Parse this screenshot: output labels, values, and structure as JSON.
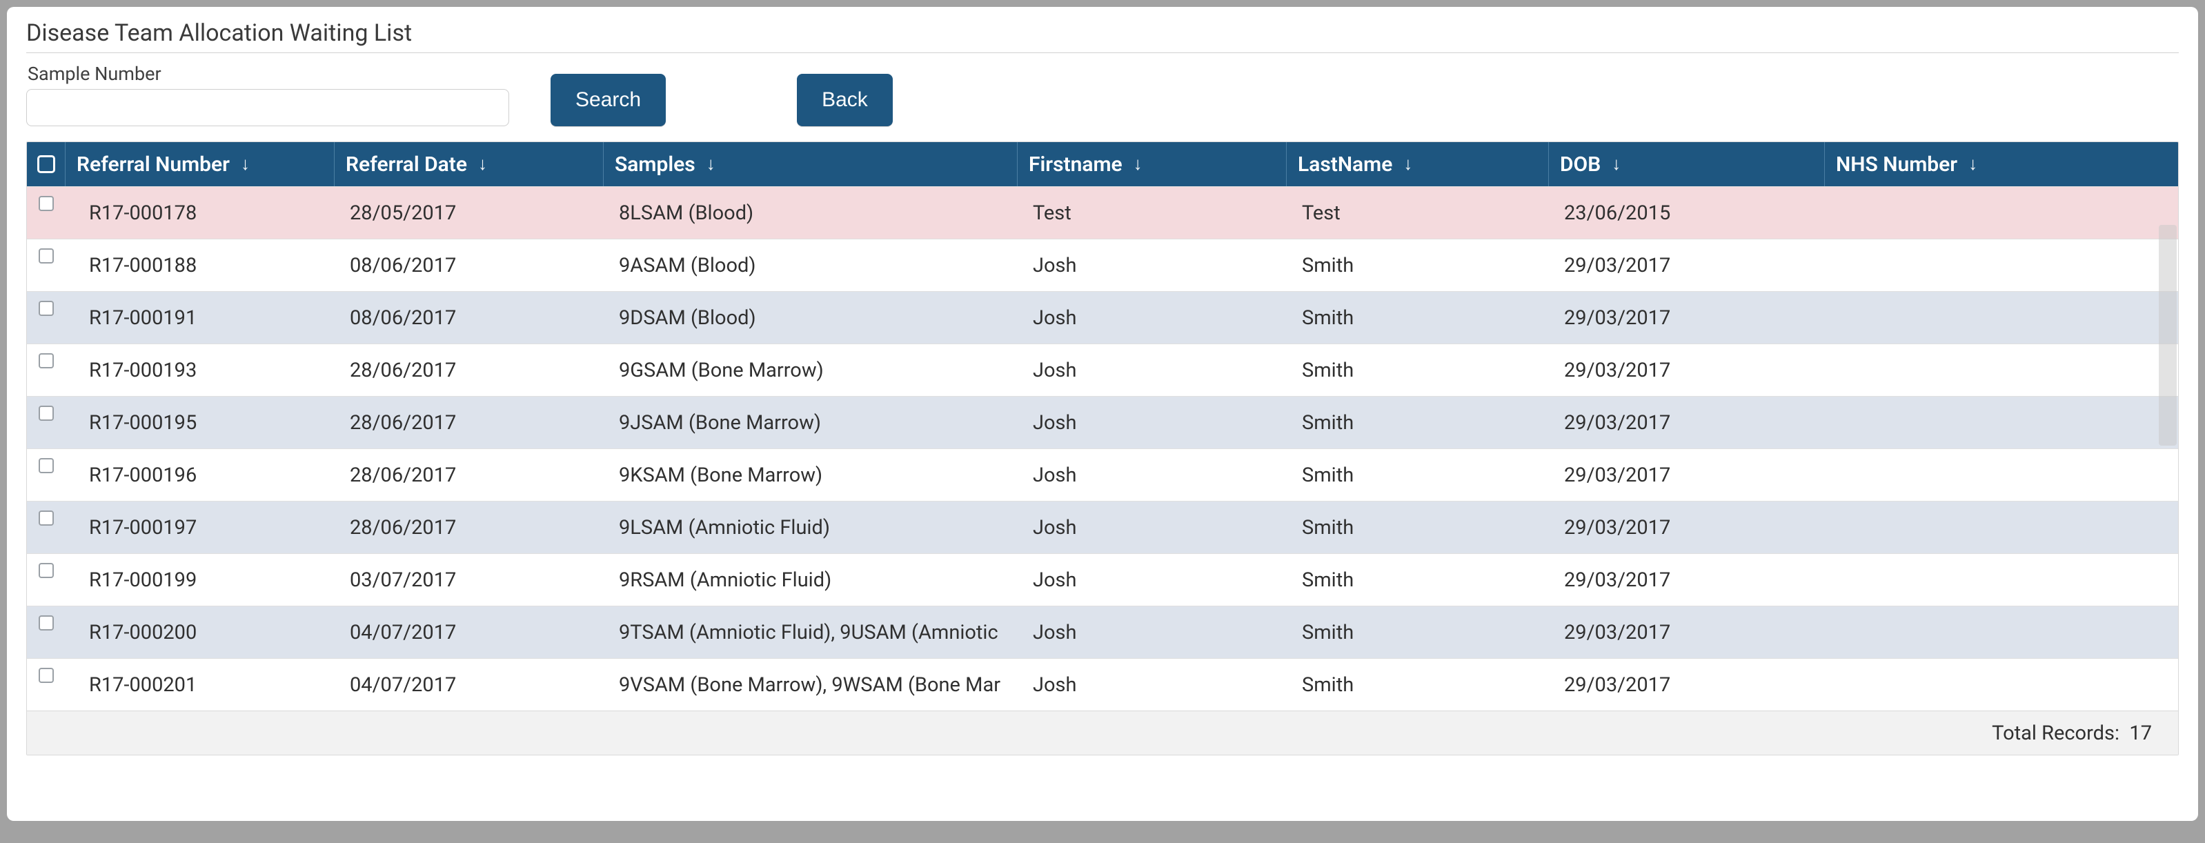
{
  "title": "Disease Team Allocation Waiting List",
  "controls": {
    "sample_number_label": "Sample Number",
    "sample_number_value": "",
    "search_label": "Search",
    "back_label": "Back"
  },
  "columns": {
    "referral_number": "Referral Number",
    "referral_date": "Referral Date",
    "samples": "Samples",
    "firstname": "Firstname",
    "lastname": "LastName",
    "dob": "DOB",
    "nhs_number": "NHS Number"
  },
  "rows": [
    {
      "ref": "R17-000178",
      "date": "28/05/2017",
      "samples": "8LSAM (Blood)",
      "first": "Test",
      "last": "Test",
      "dob": "23/06/2015",
      "nhs": "",
      "highlight": true
    },
    {
      "ref": "R17-000188",
      "date": "08/06/2017",
      "samples": "9ASAM (Blood)",
      "first": "Josh",
      "last": "Smith",
      "dob": "29/03/2017",
      "nhs": ""
    },
    {
      "ref": "R17-000191",
      "date": "08/06/2017",
      "samples": "9DSAM (Blood)",
      "first": "Josh",
      "last": "Smith",
      "dob": "29/03/2017",
      "nhs": ""
    },
    {
      "ref": "R17-000193",
      "date": "28/06/2017",
      "samples": "9GSAM (Bone Marrow)",
      "first": "Josh",
      "last": "Smith",
      "dob": "29/03/2017",
      "nhs": ""
    },
    {
      "ref": "R17-000195",
      "date": "28/06/2017",
      "samples": "9JSAM (Bone Marrow)",
      "first": "Josh",
      "last": "Smith",
      "dob": "29/03/2017",
      "nhs": ""
    },
    {
      "ref": "R17-000196",
      "date": "28/06/2017",
      "samples": "9KSAM (Bone Marrow)",
      "first": "Josh",
      "last": "Smith",
      "dob": "29/03/2017",
      "nhs": ""
    },
    {
      "ref": "R17-000197",
      "date": "28/06/2017",
      "samples": "9LSAM (Amniotic Fluid)",
      "first": "Josh",
      "last": "Smith",
      "dob": "29/03/2017",
      "nhs": ""
    },
    {
      "ref": "R17-000199",
      "date": "03/07/2017",
      "samples": "9RSAM (Amniotic Fluid)",
      "first": "Josh",
      "last": "Smith",
      "dob": "29/03/2017",
      "nhs": ""
    },
    {
      "ref": "R17-000200",
      "date": "04/07/2017",
      "samples": "9TSAM (Amniotic Fluid), 9USAM (Amniotic",
      "first": "Josh",
      "last": "Smith",
      "dob": "29/03/2017",
      "nhs": ""
    },
    {
      "ref": "R17-000201",
      "date": "04/07/2017",
      "samples": "9VSAM (Bone Marrow), 9WSAM (Bone Mar",
      "first": "Josh",
      "last": "Smith",
      "dob": "29/03/2017",
      "nhs": ""
    }
  ],
  "footer": {
    "total_label": "Total Records:",
    "total_value": "17"
  }
}
